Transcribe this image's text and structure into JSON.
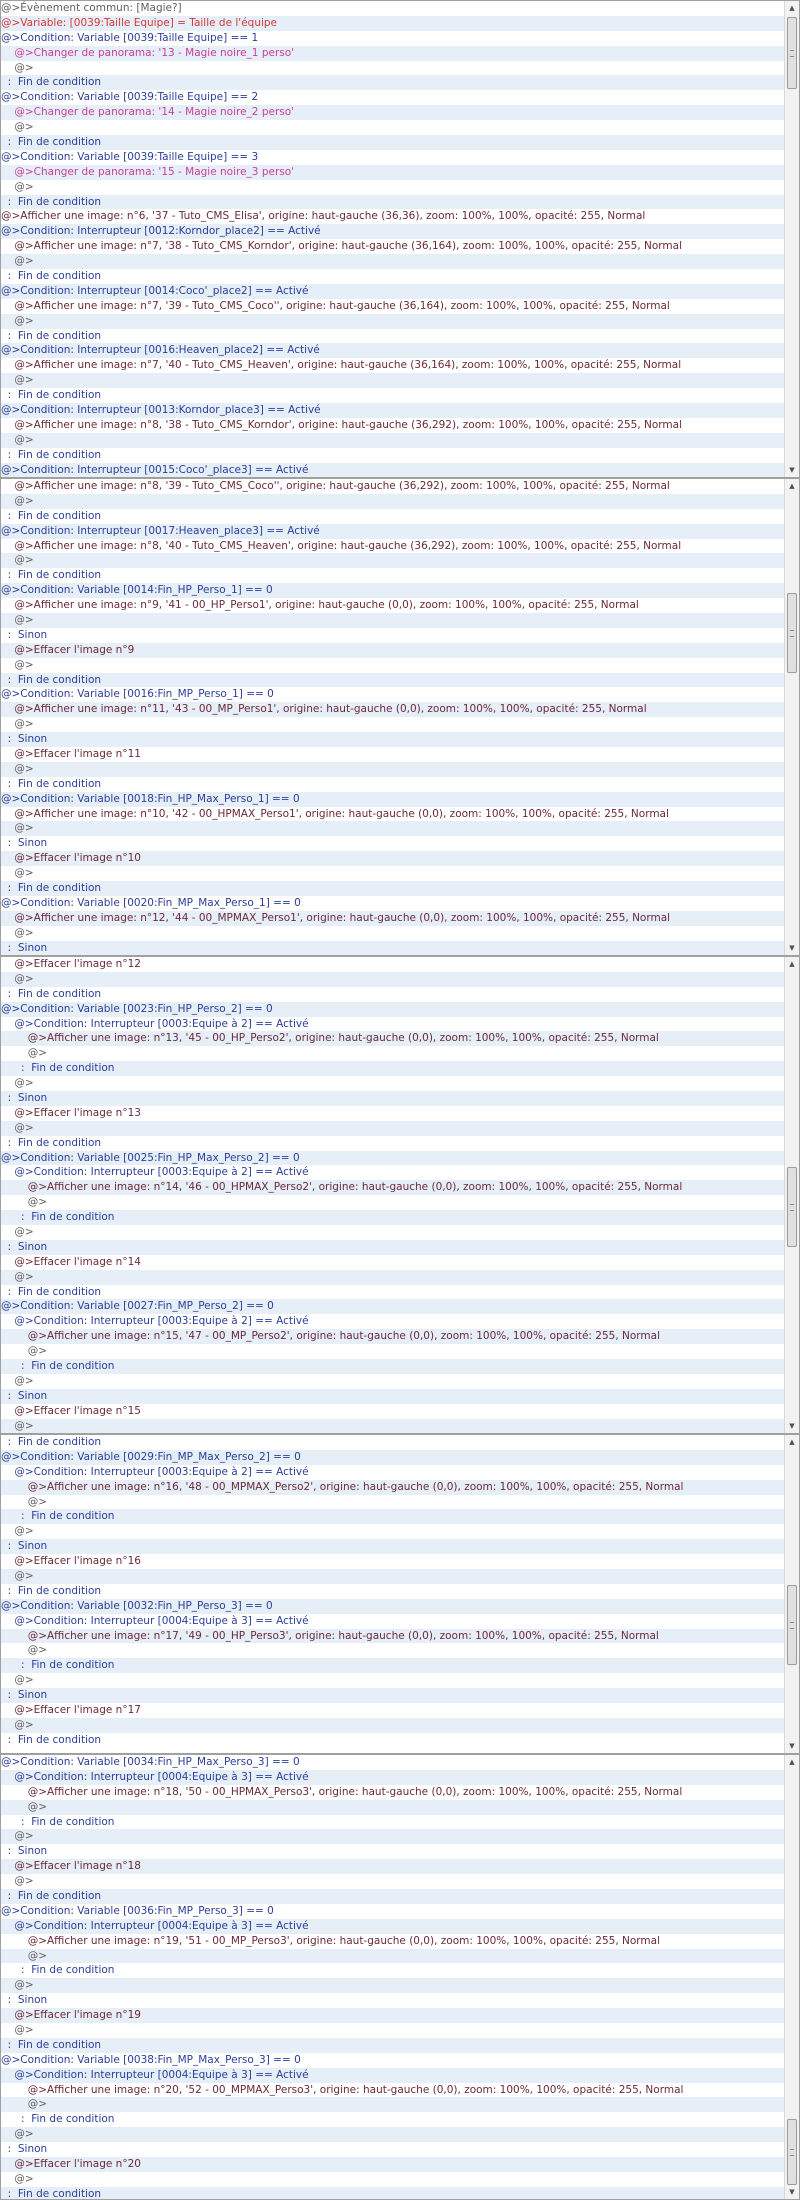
{
  "panels": [
    {
      "rows": [
        {
          "t": "@>Évènement commun: [Magie?]",
          "c": "gray"
        },
        {
          "t": "@>Variable: [0039:Taille Equipe] = Taille de l'équipe",
          "c": "var"
        },
        {
          "t": "@>Condition: Variable [0039:Taille Equipe] == 1",
          "c": "cond"
        },
        {
          "t": "    @>Changer de panorama: '13 - Magie noire_1 perso'",
          "c": "pink"
        },
        {
          "t": "    @>",
          "c": "gray"
        },
        {
          "t": "  :  Fin de condition",
          "c": "cond"
        },
        {
          "t": "@>Condition: Variable [0039:Taille Equipe] == 2",
          "c": "cond"
        },
        {
          "t": "    @>Changer de panorama: '14 - Magie noire_2 perso'",
          "c": "pink"
        },
        {
          "t": "    @>",
          "c": "gray"
        },
        {
          "t": "  :  Fin de condition",
          "c": "cond"
        },
        {
          "t": "@>Condition: Variable [0039:Taille Equipe] == 3",
          "c": "cond"
        },
        {
          "t": "    @>Changer de panorama: '15 - Magie noire_3 perso'",
          "c": "pink"
        },
        {
          "t": "    @>",
          "c": "gray"
        },
        {
          "t": "  :  Fin de condition",
          "c": "cond"
        },
        {
          "t": "@>Afficher une image: n°6, '37 - Tuto_CMS_Elisa', origine: haut-gauche (36,36), zoom: 100%, 100%, opacité: 255, Normal",
          "c": "img"
        },
        {
          "t": "@>Condition: Interrupteur [0012:Korndor_place2] == Activé",
          "c": "cond"
        },
        {
          "t": "    @>Afficher une image: n°7, '38 - Tuto_CMS_Korndor', origine: haut-gauche (36,164), zoom: 100%, 100%, opacité: 255, Normal",
          "c": "img"
        },
        {
          "t": "    @>",
          "c": "gray"
        },
        {
          "t": "  :  Fin de condition",
          "c": "cond"
        },
        {
          "t": "@>Condition: Interrupteur [0014:Coco'_place2] == Activé",
          "c": "cond"
        },
        {
          "t": "    @>Afficher une image: n°7, '39 - Tuto_CMS_Coco'', origine: haut-gauche (36,164), zoom: 100%, 100%, opacité: 255, Normal",
          "c": "img"
        },
        {
          "t": "    @>",
          "c": "gray"
        },
        {
          "t": "  :  Fin de condition",
          "c": "cond"
        },
        {
          "t": "@>Condition: Interrupteur [0016:Heaven_place2] == Activé",
          "c": "cond"
        },
        {
          "t": "    @>Afficher une image: n°7, '40 - Tuto_CMS_Heaven', origine: haut-gauche (36,164), zoom: 100%, 100%, opacité: 255, Normal",
          "c": "img"
        },
        {
          "t": "    @>",
          "c": "gray"
        },
        {
          "t": "  :  Fin de condition",
          "c": "cond"
        },
        {
          "t": "@>Condition: Interrupteur [0013:Korndor_place3] == Activé",
          "c": "cond"
        },
        {
          "t": "    @>Afficher une image: n°8, '38 - Tuto_CMS_Korndor', origine: haut-gauche (36,292), zoom: 100%, 100%, opacité: 255, Normal",
          "c": "img"
        },
        {
          "t": "    @>",
          "c": "gray"
        },
        {
          "t": "  :  Fin de condition",
          "c": "cond"
        },
        {
          "t": "@>Condition: Interrupteur [0015:Coco'_place3] == Activé",
          "c": "cond"
        }
      ]
    },
    {
      "rows": [
        {
          "t": "    @>Afficher une image: n°8, '39 - Tuto_CMS_Coco'', origine: haut-gauche (36,292), zoom: 100%, 100%, opacité: 255, Normal",
          "c": "img"
        },
        {
          "t": "    @>",
          "c": "gray"
        },
        {
          "t": "  :  Fin de condition",
          "c": "cond"
        },
        {
          "t": "@>Condition: Interrupteur [0017:Heaven_place3] == Activé",
          "c": "cond"
        },
        {
          "t": "    @>Afficher une image: n°8, '40 - Tuto_CMS_Heaven', origine: haut-gauche (36,292), zoom: 100%, 100%, opacité: 255, Normal",
          "c": "img"
        },
        {
          "t": "    @>",
          "c": "gray"
        },
        {
          "t": "  :  Fin de condition",
          "c": "cond"
        },
        {
          "t": "@>Condition: Variable [0014:Fin_HP_Perso_1] == 0",
          "c": "cond"
        },
        {
          "t": "    @>Afficher une image: n°9, '41 - 00_HP_Perso1', origine: haut-gauche (0,0), zoom: 100%, 100%, opacité: 255, Normal",
          "c": "img"
        },
        {
          "t": "    @>",
          "c": "gray"
        },
        {
          "t": "  :  Sinon",
          "c": "cond"
        },
        {
          "t": "    @>Effacer l'image n°9",
          "c": "img"
        },
        {
          "t": "    @>",
          "c": "gray"
        },
        {
          "t": "  :  Fin de condition",
          "c": "cond"
        },
        {
          "t": "@>Condition: Variable [0016:Fin_MP_Perso_1] == 0",
          "c": "cond"
        },
        {
          "t": "    @>Afficher une image: n°11, '43 - 00_MP_Perso1', origine: haut-gauche (0,0), zoom: 100%, 100%, opacité: 255, Normal",
          "c": "img"
        },
        {
          "t": "    @>",
          "c": "gray"
        },
        {
          "t": "  :  Sinon",
          "c": "cond"
        },
        {
          "t": "    @>Effacer l'image n°11",
          "c": "img"
        },
        {
          "t": "    @>",
          "c": "gray"
        },
        {
          "t": "  :  Fin de condition",
          "c": "cond"
        },
        {
          "t": "@>Condition: Variable [0018:Fin_HP_Max_Perso_1] == 0",
          "c": "cond"
        },
        {
          "t": "    @>Afficher une image: n°10, '42 - 00_HPMAX_Perso1', origine: haut-gauche (0,0), zoom: 100%, 100%, opacité: 255, Normal",
          "c": "img"
        },
        {
          "t": "    @>",
          "c": "gray"
        },
        {
          "t": "  :  Sinon",
          "c": "cond"
        },
        {
          "t": "    @>Effacer l'image n°10",
          "c": "img"
        },
        {
          "t": "    @>",
          "c": "gray"
        },
        {
          "t": "  :  Fin de condition",
          "c": "cond"
        },
        {
          "t": "@>Condition: Variable [0020:Fin_MP_Max_Perso_1] == 0",
          "c": "cond"
        },
        {
          "t": "    @>Afficher une image: n°12, '44 - 00_MPMAX_Perso1', origine: haut-gauche (0,0), zoom: 100%, 100%, opacité: 255, Normal",
          "c": "img"
        },
        {
          "t": "    @>",
          "c": "gray"
        },
        {
          "t": "  :  Sinon",
          "c": "cond"
        }
      ]
    },
    {
      "rows": [
        {
          "t": "    @>Effacer l'image n°12",
          "c": "img"
        },
        {
          "t": "    @>",
          "c": "gray"
        },
        {
          "t": "  :  Fin de condition",
          "c": "cond"
        },
        {
          "t": "@>Condition: Variable [0023:Fin_HP_Perso_2] == 0",
          "c": "cond"
        },
        {
          "t": "    @>Condition: Interrupteur [0003:Equipe à 2] == Activé",
          "c": "cond"
        },
        {
          "t": "        @>Afficher une image: n°13, '45 - 00_HP_Perso2', origine: haut-gauche (0,0), zoom: 100%, 100%, opacité: 255, Normal",
          "c": "img"
        },
        {
          "t": "        @>",
          "c": "gray"
        },
        {
          "t": "      :  Fin de condition",
          "c": "cond"
        },
        {
          "t": "    @>",
          "c": "gray"
        },
        {
          "t": "  :  Sinon",
          "c": "cond"
        },
        {
          "t": "    @>Effacer l'image n°13",
          "c": "img"
        },
        {
          "t": "    @>",
          "c": "gray"
        },
        {
          "t": "  :  Fin de condition",
          "c": "cond"
        },
        {
          "t": "@>Condition: Variable [0025:Fin_HP_Max_Perso_2] == 0",
          "c": "cond"
        },
        {
          "t": "    @>Condition: Interrupteur [0003:Equipe à 2] == Activé",
          "c": "cond"
        },
        {
          "t": "        @>Afficher une image: n°14, '46 - 00_HPMAX_Perso2', origine: haut-gauche (0,0), zoom: 100%, 100%, opacité: 255, Normal",
          "c": "img"
        },
        {
          "t": "        @>",
          "c": "gray"
        },
        {
          "t": "      :  Fin de condition",
          "c": "cond"
        },
        {
          "t": "    @>",
          "c": "gray"
        },
        {
          "t": "  :  Sinon",
          "c": "cond"
        },
        {
          "t": "    @>Effacer l'image n°14",
          "c": "img"
        },
        {
          "t": "    @>",
          "c": "gray"
        },
        {
          "t": "  :  Fin de condition",
          "c": "cond"
        },
        {
          "t": "@>Condition: Variable [0027:Fin_MP_Perso_2] == 0",
          "c": "cond"
        },
        {
          "t": "    @>Condition: Interrupteur [0003:Equipe à 2] == Activé",
          "c": "cond"
        },
        {
          "t": "        @>Afficher une image: n°15, '47 - 00_MP_Perso2', origine: haut-gauche (0,0), zoom: 100%, 100%, opacité: 255, Normal",
          "c": "img"
        },
        {
          "t": "        @>",
          "c": "gray"
        },
        {
          "t": "      :  Fin de condition",
          "c": "cond"
        },
        {
          "t": "    @>",
          "c": "gray"
        },
        {
          "t": "  :  Sinon",
          "c": "cond"
        },
        {
          "t": "    @>Effacer l'image n°15",
          "c": "img"
        },
        {
          "t": "    @>",
          "c": "gray"
        }
      ]
    },
    {
      "rows": [
        {
          "t": "  :  Fin de condition",
          "c": "cond"
        },
        {
          "t": "@>Condition: Variable [0029:Fin_MP_Max_Perso_2] == 0",
          "c": "cond"
        },
        {
          "t": "    @>Condition: Interrupteur [0003:Equipe à 2] == Activé",
          "c": "cond"
        },
        {
          "t": "        @>Afficher une image: n°16, '48 - 00_MPMAX_Perso2', origine: haut-gauche (0,0), zoom: 100%, 100%, opacité: 255, Normal",
          "c": "img"
        },
        {
          "t": "        @>",
          "c": "gray"
        },
        {
          "t": "      :  Fin de condition",
          "c": "cond"
        },
        {
          "t": "    @>",
          "c": "gray"
        },
        {
          "t": "  :  Sinon",
          "c": "cond"
        },
        {
          "t": "    @>Effacer l'image n°16",
          "c": "img"
        },
        {
          "t": "    @>",
          "c": "gray"
        },
        {
          "t": "  :  Fin de condition",
          "c": "cond"
        },
        {
          "t": "@>Condition: Variable [0032:Fin_HP_Perso_3] == 0",
          "c": "cond"
        },
        {
          "t": "    @>Condition: Interrupteur [0004:Equipe à 3] == Activé",
          "c": "cond"
        },
        {
          "t": "        @>Afficher une image: n°17, '49 - 00_HP_Perso3', origine: haut-gauche (0,0), zoom: 100%, 100%, opacité: 255, Normal",
          "c": "img"
        },
        {
          "t": "        @>",
          "c": "gray"
        },
        {
          "t": "      :  Fin de condition",
          "c": "cond"
        },
        {
          "t": "    @>",
          "c": "gray"
        },
        {
          "t": "  :  Sinon",
          "c": "cond"
        },
        {
          "t": "    @>Effacer l'image n°17",
          "c": "img"
        },
        {
          "t": "    @>",
          "c": "gray"
        },
        {
          "t": "  :  Fin de condition",
          "c": "cond"
        }
      ]
    },
    {
      "rows": [
        {
          "t": "@>Condition: Variable [0034:Fin_HP_Max_Perso_3] == 0",
          "c": "cond"
        },
        {
          "t": "    @>Condition: Interrupteur [0004:Equipe à 3] == Activé",
          "c": "cond"
        },
        {
          "t": "        @>Afficher une image: n°18, '50 - 00_HPMAX_Perso3', origine: haut-gauche (0,0), zoom: 100%, 100%, opacité: 255, Normal",
          "c": "img"
        },
        {
          "t": "        @>",
          "c": "gray"
        },
        {
          "t": "      :  Fin de condition",
          "c": "cond"
        },
        {
          "t": "    @>",
          "c": "gray"
        },
        {
          "t": "  :  Sinon",
          "c": "cond"
        },
        {
          "t": "    @>Effacer l'image n°18",
          "c": "img"
        },
        {
          "t": "    @>",
          "c": "gray"
        },
        {
          "t": "  :  Fin de condition",
          "c": "cond"
        },
        {
          "t": "@>Condition: Variable [0036:Fin_MP_Perso_3] == 0",
          "c": "cond"
        },
        {
          "t": "    @>Condition: Interrupteur [0004:Equipe à 3] == Activé",
          "c": "cond"
        },
        {
          "t": "        @>Afficher une image: n°19, '51 - 00_MP_Perso3', origine: haut-gauche (0,0), zoom: 100%, 100%, opacité: 255, Normal",
          "c": "img"
        },
        {
          "t": "        @>",
          "c": "gray"
        },
        {
          "t": "      :  Fin de condition",
          "c": "cond"
        },
        {
          "t": "    @>",
          "c": "gray"
        },
        {
          "t": "  :  Sinon",
          "c": "cond"
        },
        {
          "t": "    @>Effacer l'image n°19",
          "c": "img"
        },
        {
          "t": "    @>",
          "c": "gray"
        },
        {
          "t": "  :  Fin de condition",
          "c": "cond"
        },
        {
          "t": "@>Condition: Variable [0038:Fin_MP_Max_Perso_3] == 0",
          "c": "cond"
        },
        {
          "t": "    @>Condition: Interrupteur [0004:Equipe à 3] == Activé",
          "c": "cond"
        },
        {
          "t": "        @>Afficher une image: n°20, '52 - 00_MPMAX_Perso3', origine: haut-gauche (0,0), zoom: 100%, 100%, opacité: 255, Normal",
          "c": "img"
        },
        {
          "t": "        @>",
          "c": "gray"
        },
        {
          "t": "      :  Fin de condition",
          "c": "cond"
        },
        {
          "t": "    @>",
          "c": "gray"
        },
        {
          "t": "  :  Sinon",
          "c": "cond"
        },
        {
          "t": "    @>Effacer l'image n°20",
          "c": "img"
        },
        {
          "t": "    @>",
          "c": "gray"
        },
        {
          "t": "  :  Fin de condition",
          "c": "cond"
        }
      ]
    }
  ],
  "scrollbar": {
    "up_icon": "▲",
    "down_icon": "▼"
  }
}
